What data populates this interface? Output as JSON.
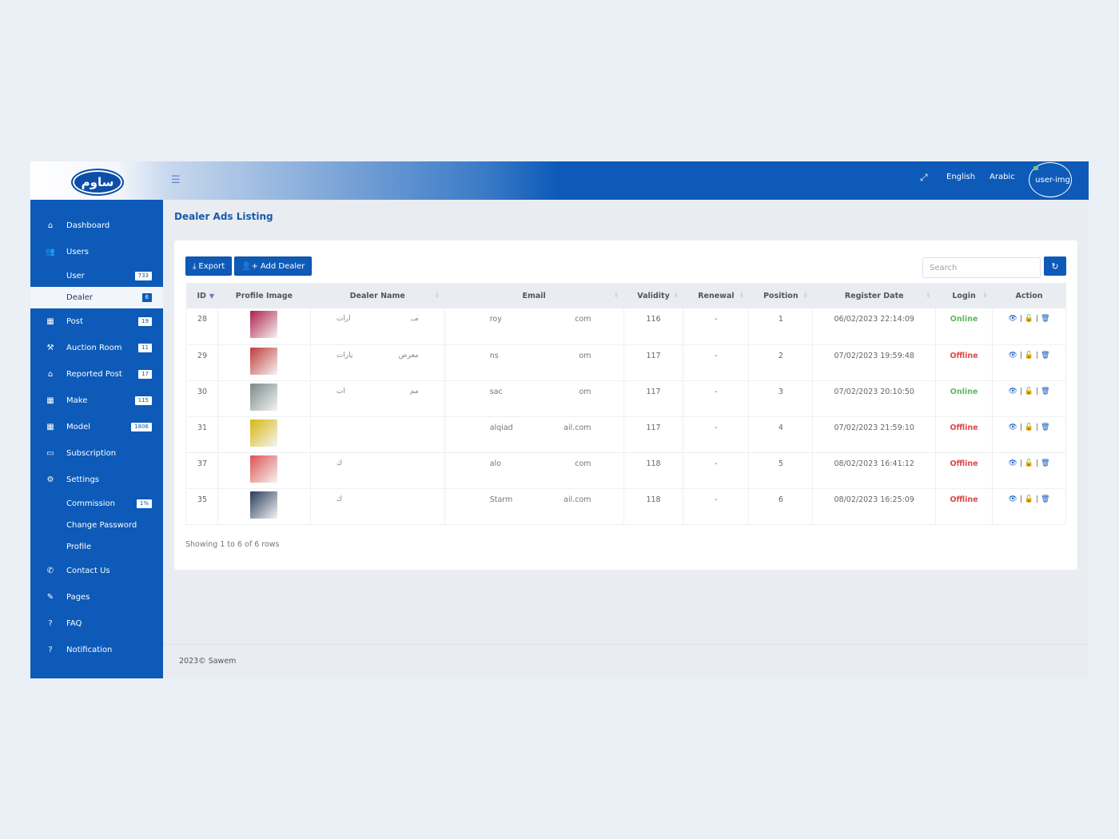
{
  "header": {
    "logo_text": "ساوم",
    "menu_icon": "hamburger-icon",
    "fullscreen_icon": "expand-icon",
    "languages": [
      "English",
      "Arabic"
    ],
    "user_img_alt": "user-img"
  },
  "sidebar": {
    "items": [
      {
        "label": "Dashboard",
        "icon": "home-icon",
        "glyph": "⌂"
      },
      {
        "label": "Users",
        "icon": "users-icon",
        "glyph": "👥"
      },
      {
        "label": "User",
        "badge": "733",
        "sub": true
      },
      {
        "label": "Dealer",
        "badge": "6",
        "sub": true,
        "active": true
      },
      {
        "label": "Post",
        "badge": "19",
        "icon": "grid-icon",
        "glyph": "▦"
      },
      {
        "label": "Auction Room",
        "badge": "11",
        "icon": "gavel-icon",
        "glyph": "⚒"
      },
      {
        "label": "Reported Post",
        "badge": "17",
        "icon": "inbox-icon",
        "glyph": "⌂"
      },
      {
        "label": "Make",
        "badge": "115",
        "icon": "table-icon",
        "glyph": "▦"
      },
      {
        "label": "Model",
        "badge": "1806",
        "icon": "table-icon",
        "glyph": "▦"
      },
      {
        "label": "Subscription",
        "icon": "credit-card-icon",
        "glyph": "▭"
      },
      {
        "label": "Settings",
        "icon": "gear-icon",
        "glyph": "⚙"
      },
      {
        "label": "Commission",
        "badge": "1%",
        "sub": true
      },
      {
        "label": "Change Password",
        "sub": true
      },
      {
        "label": "Profile",
        "sub": true
      },
      {
        "label": "Contact Us",
        "icon": "phone-icon",
        "glyph": "✆"
      },
      {
        "label": "Pages",
        "icon": "edit-icon",
        "glyph": "✎"
      },
      {
        "label": "FAQ",
        "icon": "question-icon",
        "glyph": "?"
      },
      {
        "label": "Notification",
        "icon": "question-icon",
        "glyph": "?"
      }
    ]
  },
  "page": {
    "title": "Dealer Ads Listing",
    "export_label": "Export",
    "add_dealer_label": "Add Dealer",
    "search_placeholder": "Search",
    "showing_text": "Showing 1 to 6 of 6 rows"
  },
  "table": {
    "columns": [
      "ID",
      "Profile Image",
      "Dealer Name",
      "Email",
      "Validity",
      "Renewal",
      "Position",
      "Register Date",
      "Login",
      "Action"
    ],
    "rows": [
      {
        "id": "28",
        "img_color": "#b0204a",
        "name_left": "ارات",
        "name_right": "مــ",
        "email_left": "roy",
        "email_right": "com",
        "validity": "116",
        "renewal": "-",
        "position": "1",
        "date": "06/02/2023 22:14:09",
        "login": "Online"
      },
      {
        "id": "29",
        "img_color": "#c23a3a",
        "name_left": "يارات",
        "name_right": "معرض",
        "email_left": "ns",
        "email_right": "om",
        "validity": "117",
        "renewal": "-",
        "position": "2",
        "date": "07/02/2023 19:59:48",
        "login": "Offline"
      },
      {
        "id": "30",
        "img_color": "#7b8a88",
        "name_left": "ات",
        "name_right": "مم",
        "email_left": "sac",
        "email_right": "om",
        "validity": "117",
        "renewal": "-",
        "position": "3",
        "date": "07/02/2023 20:10:50",
        "login": "Online"
      },
      {
        "id": "31",
        "img_color": "#d8b70e",
        "name_left": "",
        "name_right": "",
        "email_left": "alqiad",
        "email_right": "ail.com",
        "validity": "117",
        "renewal": "-",
        "position": "4",
        "date": "07/02/2023 21:59:10",
        "login": "Offline"
      },
      {
        "id": "37",
        "img_color": "#e05050",
        "name_left": "ك",
        "name_right": "",
        "email_left": "alo",
        "email_right": "com",
        "validity": "118",
        "renewal": "-",
        "position": "5",
        "date": "08/02/2023 16:41:12",
        "login": "Offline"
      },
      {
        "id": "35",
        "img_color": "#2a3a5a",
        "name_left": "ك",
        "name_right": "",
        "email_left": "Starm",
        "email_right": "ail.com",
        "validity": "118",
        "renewal": "-",
        "position": "6",
        "date": "08/02/2023 16:25:09",
        "login": "Offline"
      }
    ]
  },
  "footer": {
    "text": "2023© Sawem"
  },
  "colors": {
    "primary": "#0d5ab8",
    "online": "#5cb85c",
    "offline": "#e04848"
  }
}
